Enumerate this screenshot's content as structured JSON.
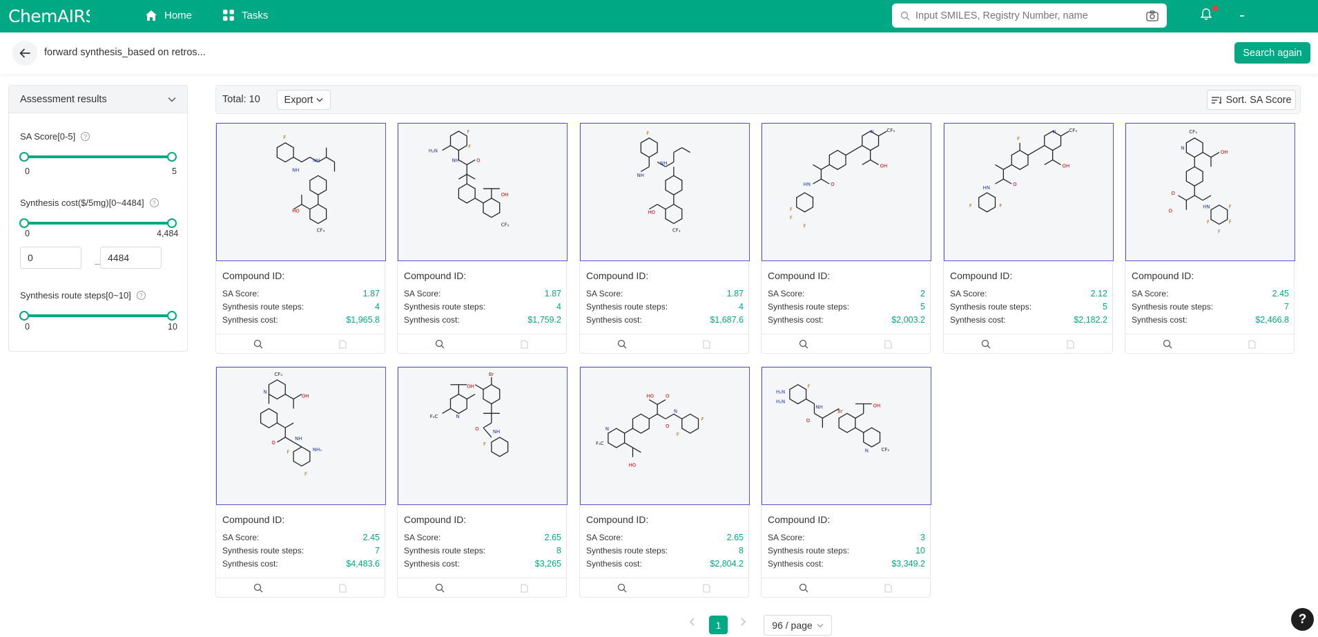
{
  "app": {
    "logo_text": "ChemAIRS"
  },
  "nav": {
    "home_label": "Home",
    "tasks_label": "Tasks"
  },
  "search": {
    "placeholder": "Input SMILES, Registry Number, name"
  },
  "subbar": {
    "title": "forward synthesis_based on retros...",
    "search_again_label": "Search again"
  },
  "filters": {
    "panel_title": "Assessment results",
    "sa_score": {
      "label": "SA Score[0-5]",
      "min": "0",
      "max": "5"
    },
    "synthesis_cost": {
      "label": "Synthesis cost($/5mg)[0~4484]",
      "min": "0",
      "max": "4,484",
      "input_min": "0",
      "input_max": "4484",
      "range_separator": "—"
    },
    "route_steps": {
      "label": "Synthesis route steps[0~10]",
      "min": "0",
      "max": "10"
    }
  },
  "toolbar": {
    "total": "Total: 10",
    "export_label": "Export",
    "sort_label": "Sort. SA Score"
  },
  "card_labels": {
    "compound_id": "Compound ID:",
    "sa_score": "SA Score:",
    "route_steps": "Synthesis route steps:",
    "cost": "Synthesis cost:"
  },
  "compounds": [
    {
      "sa_score": "1.87",
      "route_steps": "4",
      "cost": "$1,965.8"
    },
    {
      "sa_score": "1.87",
      "route_steps": "4",
      "cost": "$1,759.2"
    },
    {
      "sa_score": "1.87",
      "route_steps": "4",
      "cost": "$1,687.6"
    },
    {
      "sa_score": "2",
      "route_steps": "5",
      "cost": "$2,003.2"
    },
    {
      "sa_score": "2.12",
      "route_steps": "5",
      "cost": "$2,182.2"
    },
    {
      "sa_score": "2.45",
      "route_steps": "7",
      "cost": "$2,466.8"
    },
    {
      "sa_score": "2.45",
      "route_steps": "7",
      "cost": "$4,483.6"
    },
    {
      "sa_score": "2.65",
      "route_steps": "8",
      "cost": "$3,265"
    },
    {
      "sa_score": "2.65",
      "route_steps": "8",
      "cost": "$2,804.2"
    },
    {
      "sa_score": "3",
      "route_steps": "10",
      "cost": "$3,349.2"
    }
  ],
  "pagination": {
    "current_page": "1",
    "page_size": "96 / page"
  },
  "help": {
    "label": "?"
  },
  "colors": {
    "brand": "#00a983",
    "value_text": "#00a983",
    "card_border": "#5b4fd8",
    "notification_dot": "#f23a3a"
  },
  "icons": {
    "nav_home": "home-icon",
    "nav_tasks": "grid-icon",
    "search": "search-icon",
    "camera": "camera-icon",
    "notifications": "bell-icon",
    "back": "arrow-left-icon",
    "collapse": "chevron-down-icon",
    "sort": "sort-icon",
    "card_view": "search-icon",
    "card_doc": "document-icon"
  }
}
